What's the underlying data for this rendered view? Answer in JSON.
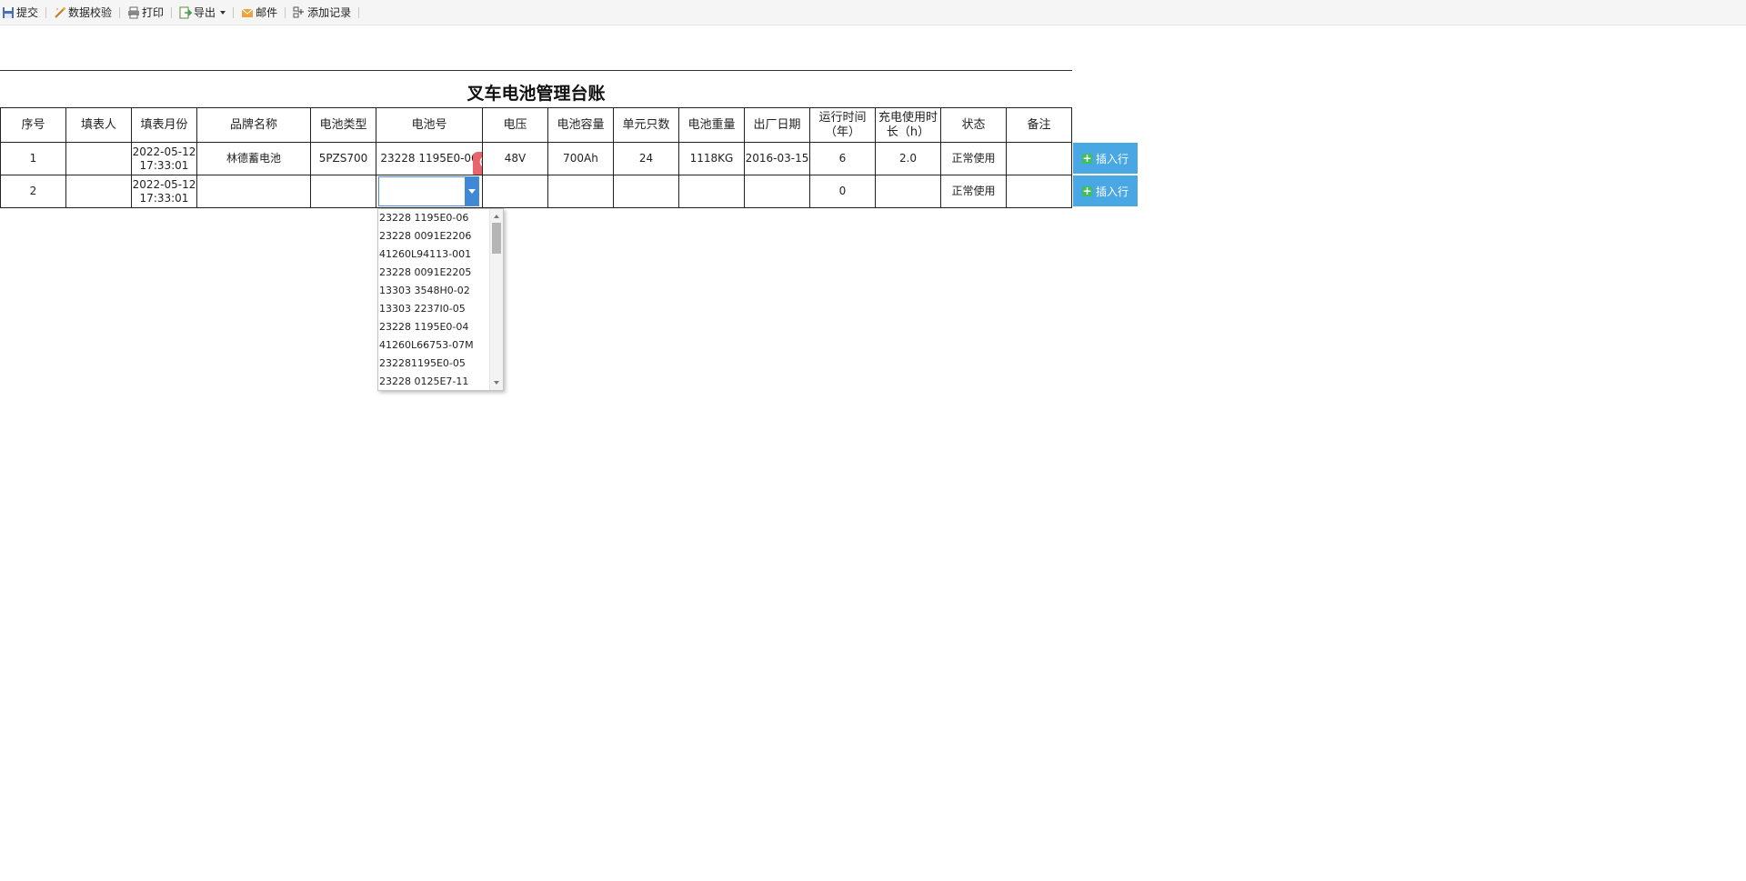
{
  "toolbar": {
    "submit": "提交",
    "validate": "数据校验",
    "print": "打印",
    "export": "导出",
    "mail": "邮件",
    "add_record": "添加记录"
  },
  "report": {
    "title": "叉车电池管理台账",
    "headers": [
      "序号",
      "填表人",
      "填表月份",
      "品牌名称",
      "电池类型",
      "电池号",
      "电压",
      "电池容量",
      "单元只数",
      "电池重量",
      "出厂日期",
      "运行时间（年）",
      "充电使用时长（h）",
      "状态",
      "备注"
    ],
    "rows": [
      {
        "no": "1",
        "filler": "",
        "month": "2022-05-12 17:33:01",
        "brand": "林德蓄电池",
        "type": "5PZS700",
        "battery_no": "23228 1195E0-06",
        "voltage": "48V",
        "capacity": "700Ah",
        "cells": "24",
        "weight": "1118KG",
        "factory_date": "2016-03-15",
        "run_years": "6",
        "charge_hours": "2.0",
        "status": "正常使用",
        "remark": ""
      },
      {
        "no": "2",
        "filler": "",
        "month": "2022-05-12 17:33:01",
        "brand": "",
        "type": "",
        "battery_no": "",
        "voltage": "",
        "capacity": "",
        "cells": "",
        "weight": "",
        "factory_date": "",
        "run_years": "0",
        "charge_hours": "",
        "status": "正常使用",
        "remark": ""
      }
    ],
    "insert_label": "插入行"
  },
  "dropdown": {
    "options": [
      "23228 1195E0-06",
      "23228 0091E2206",
      "41260L94113-001",
      "23228 0091E2205",
      "13303 3548H0-02",
      "13303 2237I0-05",
      "23228 1195E0-04",
      "41260L66753-07M",
      "232281195E0-05",
      "23228 0125E7-11"
    ]
  },
  "colors": {
    "accent": "#49a7e3",
    "search_button": "#e8666b",
    "combo_arrow": "#3f88d6",
    "plus": "#41c05a"
  }
}
